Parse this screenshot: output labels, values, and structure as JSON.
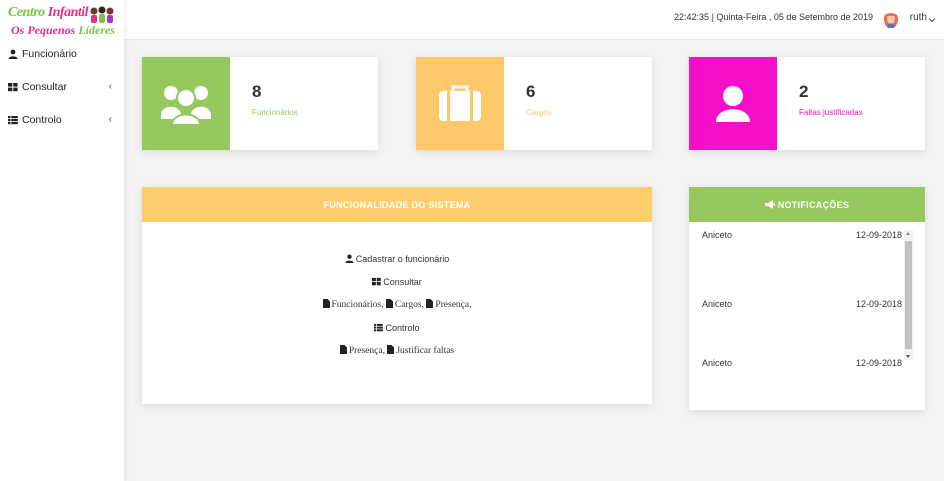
{
  "logo": {
    "line1_a": "Centro ",
    "line1_b": "Infantil",
    "line2_a": "Os Pequenos ",
    "line2_b": "Líderes"
  },
  "sidebar": {
    "items": [
      {
        "label": "Funcionário",
        "icon": "user-icon"
      },
      {
        "label": "Consultar",
        "icon": "grid-icon",
        "chevron": "‹"
      },
      {
        "label": "Controlo",
        "icon": "list-icon",
        "chevron": "‹"
      }
    ]
  },
  "topbar": {
    "datetime": "22:42:35 | Quinta-Feira , 05 de Setembro de 2019",
    "user": "ruth"
  },
  "stats": [
    {
      "value": "8",
      "label": "Funcionários",
      "color": "#96c85f",
      "icon": "users-icon"
    },
    {
      "value": "6",
      "label": "Cargos",
      "color": "#fcc96a",
      "icon": "briefcase-icon"
    },
    {
      "value": "2",
      "label": "Faltas justificadas",
      "color": "#f60fc8",
      "icon": "user-icon"
    }
  ],
  "funcionalidade": {
    "title": "FUNCIONALIDADE DO SISTEMA",
    "color": "#fccd6c",
    "lines": {
      "cadastrar": "Cadastrar o funcionário",
      "consultar": "Consultar",
      "funcionarios": "Funcionários,",
      "cargos": "Cargos,",
      "presenca1": "Presença,",
      "controlo": "Controlo",
      "presenca2": "Presença,",
      "justificar": "Justificar faltas"
    }
  },
  "notificacoes": {
    "title": "NOTIFICAÇÕES",
    "color": "#96c85f",
    "items": [
      {
        "name": "Aniceto",
        "date": "12-09-2018"
      },
      {
        "name": "Aniceto",
        "date": "12-09-2018"
      },
      {
        "name": "Aniceto",
        "date": "12-09-2018"
      }
    ]
  }
}
